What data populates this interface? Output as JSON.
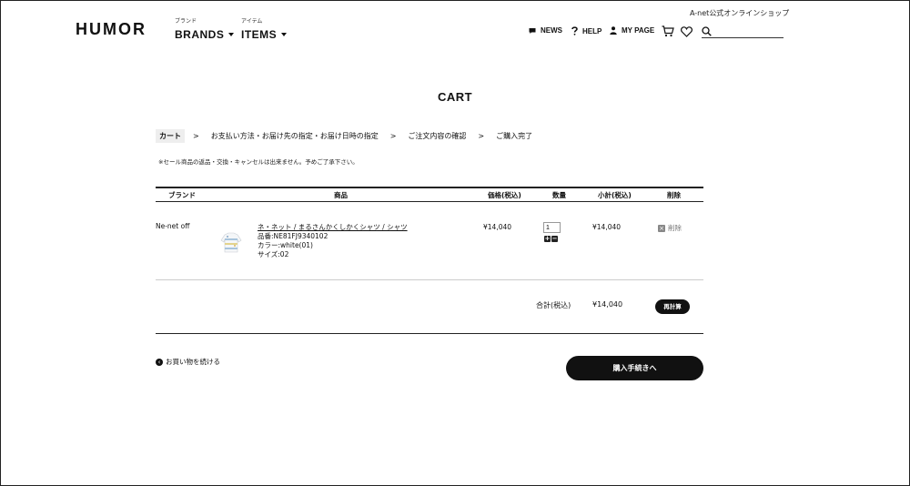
{
  "header": {
    "logo": "HUMOR",
    "brands_sub": "ブランド",
    "brands_label": "BRANDS",
    "items_sub": "アイテム",
    "items_label": "ITEMS",
    "shop_label": "A-net公式オンラインショップ",
    "news": "NEWS",
    "help": "HELP",
    "mypage": "MY PAGE",
    "search_value": ""
  },
  "page": {
    "title": "CART",
    "steps": [
      "カート",
      "お支払い方法・お届け先の指定・お届け日時の指定",
      "ご注文内容の確認",
      "ご購入完了"
    ],
    "step_separator": ">",
    "notice": "※セール商品の返品・交換・キャンセルは出来ません。予めご了承下さい。"
  },
  "table": {
    "headers": {
      "brand": "ブランド",
      "product": "商品",
      "price": "価格(税込)",
      "qty": "数量",
      "subtotal": "小計(税込)",
      "delete": "削除"
    },
    "rows": [
      {
        "brand": "Ne-net off",
        "name": "ネ・ネット / まるさんかくしかくシャツ / シャツ",
        "code": "品番:NE81FJ9340102",
        "color": "カラー:white(01)",
        "size": "サイズ:02",
        "price": "¥14,040",
        "qty": "1",
        "subtotal": "¥14,040",
        "delete_label": "削除"
      }
    ],
    "total_label": "合計(税込)",
    "total_value": "¥14,040",
    "recalc_label": "再計算"
  },
  "actions": {
    "continue_label": "お買い物を続ける",
    "checkout_label": "購入手続きへ"
  },
  "icons": {
    "news": "chat-bubble-icon",
    "help": "question-icon",
    "mypage": "user-icon",
    "cart": "cart-icon",
    "favorite": "heart-icon",
    "search": "search-icon"
  }
}
